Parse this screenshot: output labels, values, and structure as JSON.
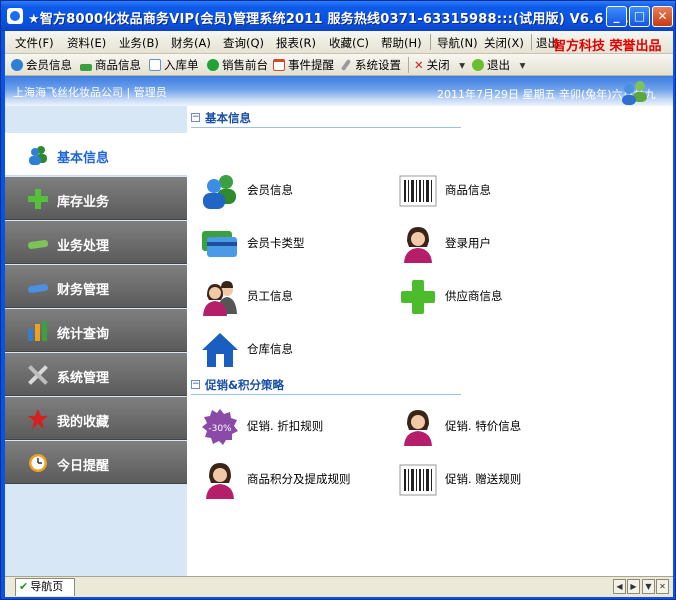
{
  "window": {
    "title": "★智方8000化妆品商务VIP(会员)管理系统2011  服务热线0371-63315988:::(试用版) V6.6  :...",
    "min_glyph": "_",
    "max_glyph": "□",
    "close_glyph": "✕"
  },
  "menubar": {
    "items": [
      "文件(F)",
      "资料(E)",
      "业务(B)",
      "财务(A)",
      "查询(Q)",
      "报表(R)",
      "收藏(C)",
      "帮助(H)",
      "导航(N)",
      "关闭(X)",
      "退出"
    ],
    "brand": "智方科技 荣誉出品"
  },
  "toolbar": {
    "items": [
      {
        "label": "会员信息",
        "icon": "members-icon",
        "color": "#2f7fd6"
      },
      {
        "label": "商品信息",
        "icon": "goods-icon",
        "color": "#3aa040"
      },
      {
        "label": "入库单",
        "icon": "document-icon",
        "color": "#6a8fc0"
      },
      {
        "label": "销售前台",
        "icon": "check-circle-icon",
        "color": "#22a236"
      },
      {
        "label": "事件提醒",
        "icon": "calendar-icon",
        "color": "#d24a2a"
      },
      {
        "label": "系统设置",
        "icon": "wrench-icon",
        "color": "#7a7a7a"
      },
      {
        "label": "关闭",
        "icon": "close-x-icon",
        "color": "#d02020"
      },
      {
        "label": "退出",
        "icon": "exit-icon",
        "color": "#6bbf2e"
      }
    ],
    "dropdown_glyph": "▾"
  },
  "header": {
    "company": "上海海飞丝化妆品公司  |  管理员",
    "date": "2011年7月29日    星期五    辛卯(兔年)六月廿九"
  },
  "sidebar": {
    "items": [
      {
        "label": "基本信息",
        "icon": "members-icon",
        "active": true
      },
      {
        "label": "库存业务",
        "icon": "plus-icon",
        "active": false
      },
      {
        "label": "业务处理",
        "icon": "card-icon",
        "active": false
      },
      {
        "label": "财务管理",
        "icon": "money-icon",
        "active": false
      },
      {
        "label": "统计查询",
        "icon": "bar-chart-icon",
        "active": false
      },
      {
        "label": "系统管理",
        "icon": "tools-icon",
        "active": false
      },
      {
        "label": "我的收藏",
        "icon": "star-icon",
        "active": false
      },
      {
        "label": "今日提醒",
        "icon": "clock-icon",
        "active": false
      }
    ]
  },
  "sections": [
    {
      "title": "基本信息",
      "tiles": [
        {
          "label": "会员信息",
          "icon": "members-icon"
        },
        {
          "label": "商品信息",
          "icon": "barcode-icon"
        },
        {
          "label": "会员卡类型",
          "icon": "cards-icon"
        },
        {
          "label": "登录用户",
          "icon": "user-icon"
        },
        {
          "label": "员工信息",
          "icon": "staff-icon"
        },
        {
          "label": "供应商信息",
          "icon": "plus-icon"
        },
        {
          "label": "仓库信息",
          "icon": "house-icon"
        }
      ]
    },
    {
      "title": "促销&积分策略",
      "tiles": [
        {
          "label": "促销. 折扣规则",
          "icon": "discount-badge-icon",
          "badge_text": "-30%"
        },
        {
          "label": "促销. 特价信息",
          "icon": "user-icon"
        },
        {
          "label": "商品积分及提成规则",
          "icon": "user-icon"
        },
        {
          "label": "促销. 赠送规则",
          "icon": "barcode-icon"
        }
      ]
    }
  ],
  "tabbar": {
    "tab_label": "导航页",
    "tab_check": "✔"
  }
}
